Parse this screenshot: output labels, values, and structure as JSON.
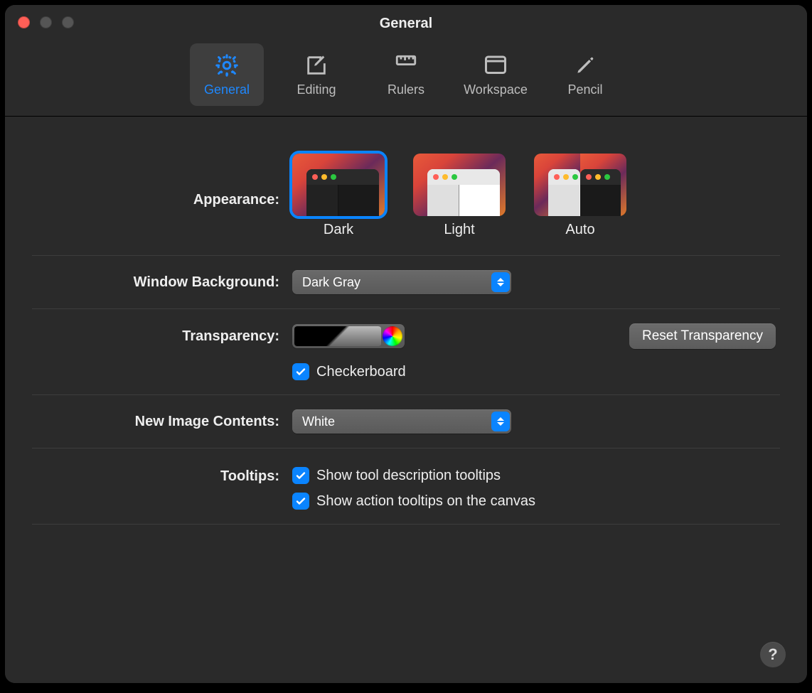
{
  "window": {
    "title": "General"
  },
  "tabs": {
    "general": "General",
    "editing": "Editing",
    "rulers": "Rulers",
    "workspace": "Workspace",
    "pencil": "Pencil"
  },
  "labels": {
    "appearance": "Appearance:",
    "window_bg": "Window Background:",
    "transparency": "Transparency:",
    "new_image": "New Image Contents:",
    "tooltips": "Tooltips:"
  },
  "appearance": {
    "dark": "Dark",
    "light": "Light",
    "auto": "Auto",
    "selected": "dark"
  },
  "window_bg": {
    "value": "Dark Gray"
  },
  "transparency": {
    "reset": "Reset Transparency",
    "checkerboard": "Checkerboard"
  },
  "new_image": {
    "value": "White"
  },
  "tooltips": {
    "desc": "Show tool description tooltips",
    "action": "Show action tooltips on the canvas"
  },
  "help": "?"
}
